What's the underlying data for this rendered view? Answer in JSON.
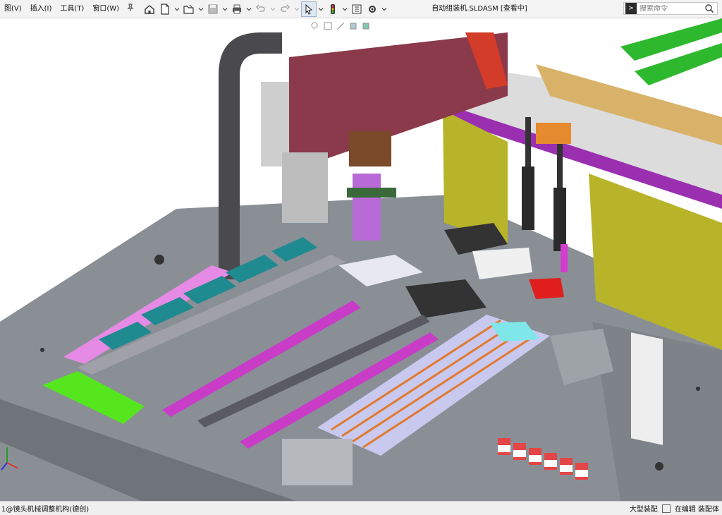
{
  "menu": {
    "items": [
      {
        "id": "view",
        "label": "图(V)"
      },
      {
        "id": "insert",
        "label": "插入(I)"
      },
      {
        "id": "tools",
        "label": "工具(T)"
      },
      {
        "id": "window",
        "label": "窗口(W)"
      }
    ],
    "pin_icon": "pin-icon"
  },
  "toolbar": {
    "icons": [
      "home-icon",
      "new-document-icon",
      "open-icon",
      "save-icon",
      "print-icon",
      "undo-icon",
      "redo-icon",
      "select-arrow-icon",
      "traffic-light-icon",
      "file-properties-icon",
      "options-gear-icon"
    ]
  },
  "document": {
    "title": "自动组装机.SLDASM [查看中]"
  },
  "search": {
    "placeholder": "搜索命令",
    "cmd_symbol": ">"
  },
  "status": {
    "left": "1@镜头机械调整机构(德创)",
    "assembly_mode": "大型装配",
    "editing": "在编辑 装配体"
  },
  "colors": {
    "accent_magenta": "#c83cc8",
    "accent_green": "#2eb82e",
    "frame_olive": "#b8b42a",
    "plate_maroon": "#8a3a4a",
    "teal": "#1f8a8f",
    "base_gray": "#8a8f96"
  }
}
